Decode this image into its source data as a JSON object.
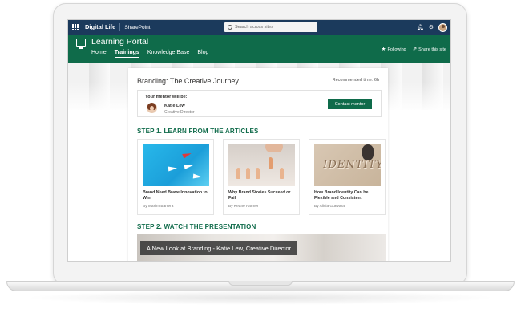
{
  "suitebar": {
    "brand": "Digital Life",
    "app": "SharePoint",
    "search_placeholder": "Search across sites"
  },
  "site": {
    "title": "Learning Portal",
    "nav": [
      "Home",
      "Trainings",
      "Knowledge Base",
      "Blog"
    ],
    "active_nav": "Trainings",
    "following_label": "Following",
    "share_label": "Share this site"
  },
  "page": {
    "title": "Branding: The Creative Journey",
    "recommended_time": "Recommended time: 6h"
  },
  "mentor": {
    "label": "Your mentor will be:",
    "name": "Katie Lew",
    "role": "Creative Director",
    "contact_label": "Contact mentor"
  },
  "step1": {
    "heading": "STEP 1. LEARN FROM THE ARTICLES",
    "articles": [
      {
        "title": "Brand Need Brave Innovation to Win",
        "author": "By Maxim Barrera"
      },
      {
        "title": "Why Brand Stories Succeed or Fail",
        "author": "By Keane Farmer"
      },
      {
        "title": "How Brand Identity Can be Flexible and Consistent",
        "author": "By Alicia Guevara"
      }
    ]
  },
  "step2": {
    "heading": "STEP 2. WATCH THE PRESENTATION",
    "video_caption": "A New Look at Branding - Katie Lew, Creative Director"
  },
  "colors": {
    "suite_bar": "#1b3a5c",
    "brand_green": "#0f6b4a"
  }
}
